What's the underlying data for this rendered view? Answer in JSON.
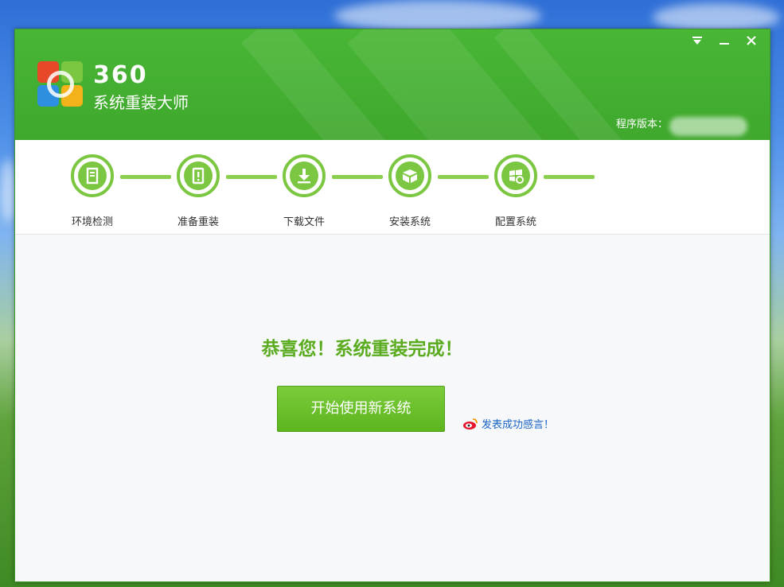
{
  "window": {
    "brand_number": "360",
    "brand_name": "系统重装大师",
    "version_label": "程序版本：",
    "controls": {
      "menu": "menu-icon",
      "minimize": "minimize-icon",
      "close": "close-icon"
    }
  },
  "steps": [
    {
      "label": "环境检测",
      "icon": "environment-check-icon"
    },
    {
      "label": "准备重装",
      "icon": "prepare-reinstall-icon"
    },
    {
      "label": "下载文件",
      "icon": "download-icon"
    },
    {
      "label": "安装系统",
      "icon": "install-box-icon"
    },
    {
      "label": "配置系统",
      "icon": "configure-windows-icon"
    }
  ],
  "main": {
    "congrats": "恭喜您！系统重装完成！",
    "start_button": "开始使用新系统",
    "share_link": "发表成功感言！"
  },
  "colors": {
    "header_green": "#3fa82d",
    "step_green": "#7cc742",
    "congrats_green": "#5aab1e",
    "button_green": "#5cb51f",
    "link_blue": "#1a64c8"
  }
}
